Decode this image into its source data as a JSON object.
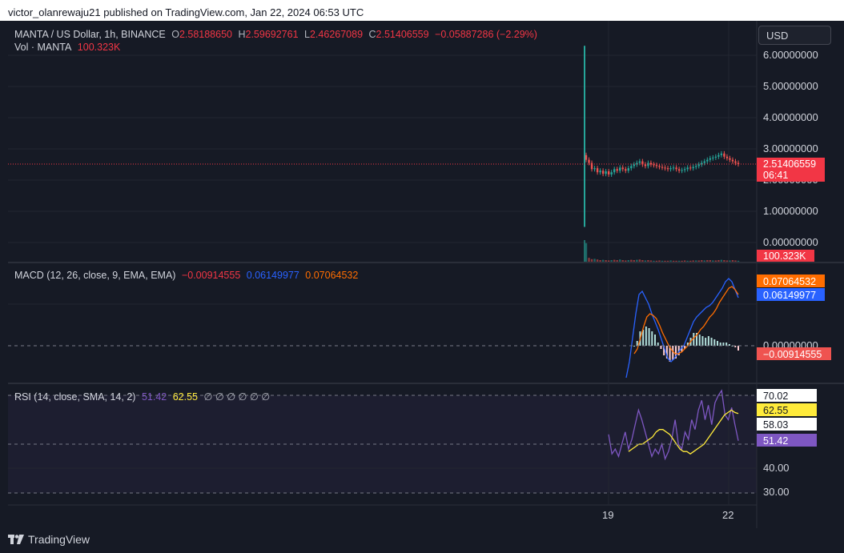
{
  "header": {
    "published_by": "victor_olanrewaju21 published on TradingView.com, Jan 22, 2024 06:53 UTC"
  },
  "currency_button": "USD",
  "branding": {
    "name": "TradingView",
    "icon": "tradingview-logo-icon"
  },
  "colors": {
    "background": "#161a25",
    "up": "#26a69a",
    "down": "#ef5350",
    "price_line": "#f23645",
    "macd": "#2962ff",
    "signal": "#ff6d00",
    "rsi": "#7e57c2",
    "rsi_ma": "#ffeb3b"
  },
  "price_pane": {
    "legend": {
      "symbol": "MANTA / US Dollar, 1h, BINANCE",
      "o_label": "O",
      "o": "2.58188650",
      "h_label": "H",
      "h": "2.59692761",
      "l_label": "L",
      "l": "2.46267089",
      "c_label": "C",
      "c": "2.51406559",
      "change": "−0.05887286 (−2.29%)"
    },
    "vol_legend": {
      "label": "Vol · MANTA",
      "value": "100.323K"
    },
    "ticks": [
      "6.00000000",
      "5.00000000",
      "4.00000000",
      "3.00000000",
      "2.00000000",
      "1.00000000",
      "0.00000000"
    ],
    "last_price_label": "2.51406559",
    "countdown": "06:41",
    "volume_label": "100.323K"
  },
  "macd_pane": {
    "legend": {
      "name": "MACD (12, 26, close, 9, EMA, EMA)",
      "hist": "−0.00914555",
      "macd": "0.06149977",
      "signal": "0.07064532"
    },
    "ticks": [
      "0.00000000"
    ],
    "labels": {
      "signal": "0.07064532",
      "macd": "0.06149977",
      "hist": "−0.00914555"
    }
  },
  "rsi_pane": {
    "legend": {
      "name": "RSI (14, close, SMA, 14, 2)",
      "rsi": "51.42",
      "rsi_ma": "62.55",
      "empty": "∅ ∅ ∅ ∅ ∅ ∅"
    },
    "ticks": [
      "70.02",
      "58.03",
      "40.00",
      "30.00"
    ],
    "labels": {
      "upper": "70.02",
      "ma": "62.55",
      "mid": "58.03",
      "rsi": "51.42"
    }
  },
  "x_axis": {
    "ticks": [
      "19",
      "22"
    ]
  },
  "chart_data": [
    {
      "type": "candlestick",
      "title": "MANTA / US Dollar, 1h, BINANCE",
      "x_ticks": [
        "19",
        "22"
      ],
      "ylim": [
        0,
        6
      ],
      "y_ticks": [
        0,
        1,
        2,
        3,
        4,
        5,
        6
      ],
      "last_close": 2.51406559,
      "series": [
        {
          "name": "MANTA",
          "close": [
            2.65,
            2.55,
            2.35,
            2.38,
            2.25,
            2.3,
            2.2,
            2.28,
            2.18,
            2.25,
            2.35,
            2.3,
            2.4,
            2.35,
            2.3,
            2.38,
            2.45,
            2.5,
            2.55,
            2.6,
            2.5,
            2.45,
            2.55,
            2.5,
            2.48,
            2.45,
            2.42,
            2.4,
            2.38,
            2.35,
            2.38,
            2.4,
            2.35,
            2.3,
            2.32,
            2.35,
            2.4,
            2.38,
            2.42,
            2.45,
            2.5,
            2.55,
            2.6,
            2.65,
            2.7,
            2.72,
            2.75,
            2.8,
            2.85,
            2.75,
            2.7,
            2.65,
            2.6,
            2.55,
            2.51
          ]
        },
        {
          "name": "Vol · MANTA",
          "values": [
            5.8,
            1.2,
            0.8,
            0.9,
            0.7,
            0.5,
            0.6,
            0.5,
            0.4,
            0.5,
            0.6,
            0.5,
            0.7,
            0.5,
            0.4,
            0.5,
            0.6,
            0.5,
            0.6,
            0.7,
            0.5,
            0.4,
            0.5,
            0.4,
            0.3,
            0.3,
            0.4,
            0.3,
            0.3,
            0.3,
            0.4,
            0.3,
            0.3,
            0.3,
            0.3,
            0.4,
            0.3,
            0.3,
            0.4,
            0.4,
            0.4,
            0.5,
            0.4,
            0.5,
            0.5,
            0.4,
            0.4,
            0.5,
            0.6,
            0.5,
            0.4,
            0.4,
            0.5,
            0.4,
            0.3
          ]
        }
      ]
    },
    {
      "type": "line",
      "title": "MACD (12, 26, close, 9, EMA, EMA)",
      "ylim": [
        -0.25,
        0.45
      ],
      "series": [
        {
          "name": "MACD",
          "values": [
            -0.2,
            -0.1,
            0.05,
            0.2,
            0.32,
            0.34,
            0.3,
            0.26,
            0.2,
            0.15,
            0.1,
            0.04,
            -0.02,
            -0.08,
            -0.1,
            -0.08,
            -0.05,
            -0.02,
            0.0,
            0.05,
            0.1,
            0.15,
            0.18,
            0.2,
            0.22,
            0.24,
            0.25,
            0.27,
            0.3,
            0.33,
            0.36,
            0.4,
            0.42,
            0.4,
            0.35,
            0.3
          ]
        },
        {
          "name": "Signal",
          "values": [
            -0.05,
            -0.02,
            0.05,
            0.12,
            0.18,
            0.2,
            0.19,
            0.17,
            0.13,
            0.08,
            0.04,
            0.0,
            -0.03,
            -0.05,
            -0.05,
            -0.04,
            -0.02,
            0.0,
            0.03,
            0.05,
            0.07,
            0.1,
            0.12,
            0.15,
            0.18,
            0.2,
            0.23,
            0.27,
            0.3,
            0.33,
            0.36,
            0.37,
            0.35,
            0.32
          ]
        },
        {
          "name": "Histogram",
          "values": [
            0.0,
            0.03,
            0.09,
            0.1,
            0.12,
            0.11,
            0.09,
            0.07,
            0.02,
            -0.02,
            -0.06,
            -0.08,
            -0.1,
            -0.09,
            -0.08,
            -0.06,
            -0.04,
            -0.02,
            0.02,
            0.05,
            0.08,
            0.08,
            0.07,
            0.06,
            0.05,
            0.06,
            0.05,
            0.04,
            0.03,
            0.02,
            0.02,
            0.02,
            0.01,
            0.0,
            -0.01,
            -0.03
          ]
        }
      ]
    },
    {
      "type": "line",
      "title": "RSI (14, close, SMA, 14, 2)",
      "ylim": [
        30,
        70.02
      ],
      "y_ticks": [
        30,
        40,
        58.03,
        70.02
      ],
      "series": [
        {
          "name": "RSI",
          "values": [
            54,
            46,
            48,
            45,
            50,
            55,
            48,
            52,
            58,
            64,
            60,
            55,
            50,
            45,
            48,
            46,
            50,
            44,
            47,
            52,
            60,
            50,
            48,
            55,
            52,
            60,
            56,
            64,
            68,
            60,
            66,
            58,
            67,
            70,
            72,
            62,
            60,
            65,
            58,
            51.42
          ]
        },
        {
          "name": "RSI MA",
          "values": [
            47,
            48,
            49,
            50,
            50,
            51,
            52,
            53,
            55,
            56,
            56,
            55,
            54,
            52,
            50,
            48,
            47,
            47,
            46,
            47,
            48,
            49,
            50,
            52,
            54,
            56,
            58,
            60,
            62,
            63,
            64,
            63,
            62.55
          ]
        }
      ]
    }
  ]
}
